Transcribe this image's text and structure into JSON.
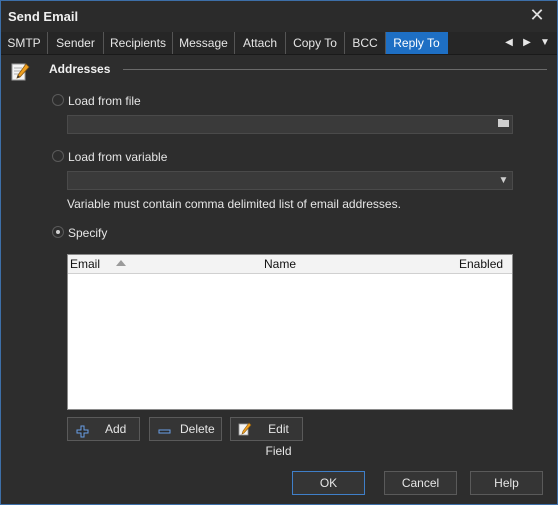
{
  "window": {
    "title": "Send Email"
  },
  "tabs": [
    {
      "label": "SMTP"
    },
    {
      "label": "Sender"
    },
    {
      "label": "Recipients"
    },
    {
      "label": "Message"
    },
    {
      "label": "Attach"
    },
    {
      "label": "Copy To"
    },
    {
      "label": "BCC"
    },
    {
      "label": "Reply To",
      "active": true
    }
  ],
  "tab_nav": {
    "prev": "◀",
    "next": "▶",
    "menu": "▼"
  },
  "section": {
    "title": "Addresses",
    "icon": "edit-document-icon"
  },
  "options": {
    "load_from_file": {
      "label": "Load from file",
      "selected": false,
      "value": "",
      "browse_icon": "folder-icon"
    },
    "load_from_variable": {
      "label": "Load from variable",
      "selected": false,
      "value": "",
      "dropdown_icon": "chevron-down-icon"
    },
    "variable_hint": "Variable must contain comma delimited list of email addresses.",
    "specify": {
      "label": "Specify",
      "selected": true
    }
  },
  "grid": {
    "columns": [
      "Email",
      "Name",
      "Enabled"
    ],
    "sort_column": "Email",
    "rows": []
  },
  "grid_buttons": {
    "add": {
      "label": "Add",
      "icon": "plus-icon"
    },
    "delete": {
      "label": "Delete",
      "icon": "minus-icon"
    },
    "edit": {
      "label": "Edit Field",
      "icon": "edit-icon"
    }
  },
  "footer": {
    "ok": "OK",
    "cancel": "Cancel",
    "help": "Help"
  },
  "colors": {
    "accent": "#1e6fc4",
    "background": "#2d2d2d",
    "field": "#3a3a3a"
  }
}
